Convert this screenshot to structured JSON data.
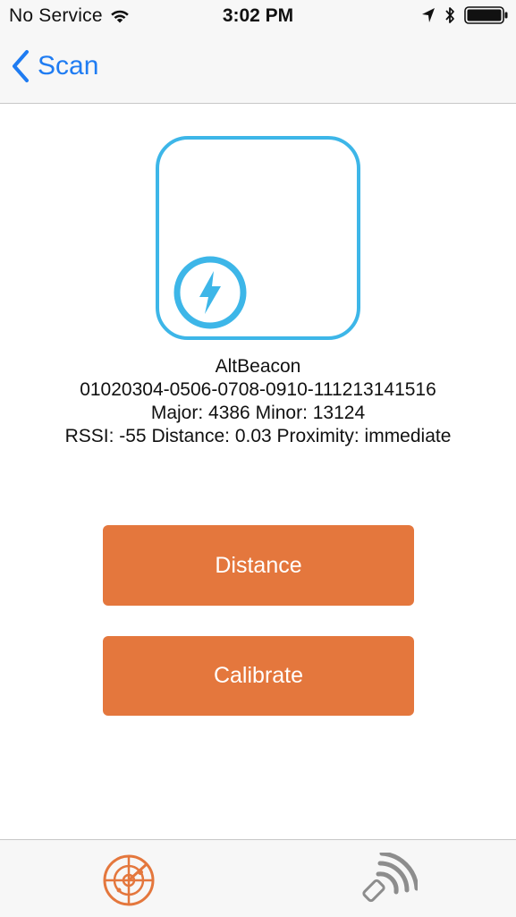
{
  "status_bar": {
    "carrier": "No Service",
    "time": "3:02 PM"
  },
  "nav": {
    "back_label": "Scan"
  },
  "beacon": {
    "type": "AltBeacon",
    "id": "01020304-0506-0708-0910-111213141516",
    "major_minor": "Major: 4386 Minor: 13124",
    "metrics": "RSSI: -55 Distance: 0.03 Proximity: immediate"
  },
  "buttons": {
    "distance": "Distance",
    "calibrate": "Calibrate"
  },
  "tabs": [
    {
      "icon": "radar-icon",
      "selected": true
    },
    {
      "icon": "broadcast-icon",
      "selected": false
    }
  ],
  "colors": {
    "accent": "#e4773d",
    "link": "#1f7cf2",
    "beacon_border": "#3db6e8"
  }
}
